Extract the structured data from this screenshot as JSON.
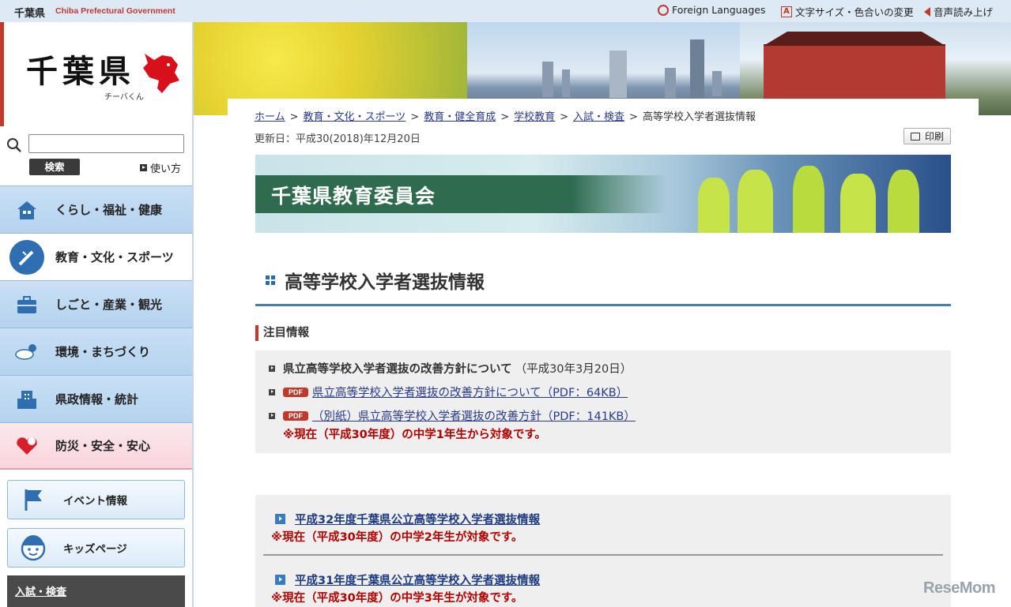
{
  "topbar": {
    "pref_name": "千葉県",
    "pref_name_en": "Chiba Prefectural Government",
    "foreign_languages": "Foreign Languages",
    "font_color": "文字サイズ・色合いの変更",
    "speech": "音声読み上げ"
  },
  "sidebar": {
    "logo_text": "千葉県",
    "logo_sub": "チーバくん",
    "search_placeholder": "",
    "search_button": "検索",
    "howto": "使い方",
    "nav": [
      {
        "label": "くらし・福祉・健康",
        "icon": "house-icon"
      },
      {
        "label": "教育・文化・スポーツ",
        "icon": "pen-icon"
      },
      {
        "label": "しごと・産業・観光",
        "icon": "briefcase-icon"
      },
      {
        "label": "環境・まちづくり",
        "icon": "weather-icon"
      },
      {
        "label": "県政情報・統計",
        "icon": "building-icon"
      },
      {
        "label": "防災・安全・安心",
        "icon": "heart-icon"
      }
    ],
    "sub_buttons": [
      {
        "label": "イベント情報",
        "icon": "flag-icon"
      },
      {
        "label": "キッズページ",
        "icon": "kid-face-icon"
      }
    ],
    "section_title": "入試・検査"
  },
  "breadcrumb": [
    {
      "label": "ホーム",
      "link": true
    },
    {
      "label": "教育・文化・スポーツ",
      "link": true
    },
    {
      "label": "教育・健全育成",
      "link": true
    },
    {
      "label": "学校教育",
      "link": true
    },
    {
      "label": "入試・検査",
      "link": true
    },
    {
      "label": "高等学校入学者選抜情報",
      "link": false
    }
  ],
  "breadcrumb_sep": ">",
  "updated": "更新日：平成30(2018)年12月20日",
  "print_label": "印刷",
  "banner_title": "千葉県教育委員会",
  "page_title": "高等学校入学者選抜情報",
  "notice": {
    "heading": "注目情報",
    "item_title": "県立高等学校入学者選抜の改善方針について",
    "item_date": "（平成30年3月20日）",
    "pdf_badge": "PDF",
    "links": [
      "県立高等学校入学者選抜の改善方針について（PDF：64KB）",
      "（別紙）県立高等学校入学者選抜の改善方針（PDF：141KB）"
    ],
    "note": "※現在（平成30年度）の中学1年生から対象です。"
  },
  "list": [
    {
      "link": "平成32年度千葉県公立高等学校入学者選抜情報",
      "note": "※現在（平成30年度）の中学2年生が対象です。"
    },
    {
      "link": "平成31年度千葉県公立高等学校入学者選抜情報",
      "note": "※現在（平成30年度）の中学3年生が対象です。"
    }
  ],
  "watermark": "ReseMom",
  "colors": {
    "accent": "#c0392b",
    "nav_blue": "#b5d2ee",
    "heading_rule": "#4a7eb0",
    "link": "#2a3a8c"
  }
}
